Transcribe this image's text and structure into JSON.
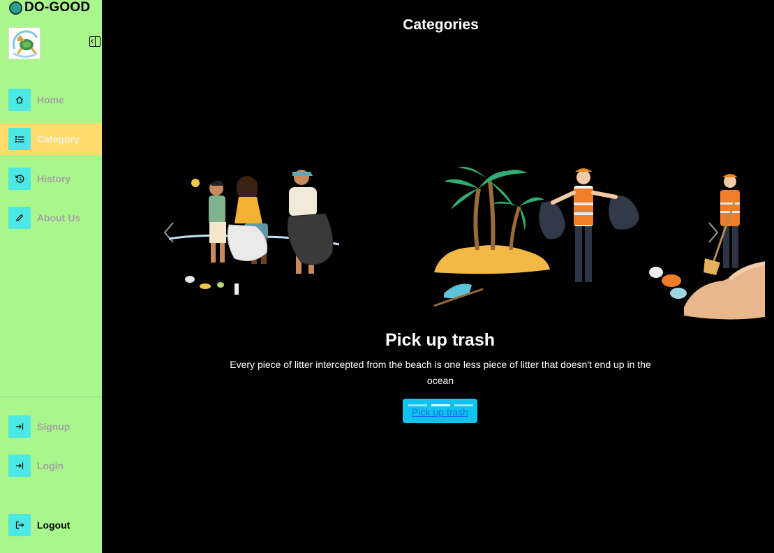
{
  "brand": {
    "name": "DO-GOOD"
  },
  "sidebar": {
    "nav": [
      {
        "label": "Home",
        "icon": "home-icon"
      },
      {
        "label": "Category",
        "icon": "list-icon",
        "active": true
      },
      {
        "label": "History",
        "icon": "history-icon"
      },
      {
        "label": "About Us",
        "icon": "pencil-icon"
      }
    ],
    "auth": [
      {
        "label": "Signup",
        "icon": "sign-in-icon"
      },
      {
        "label": "Login",
        "icon": "sign-in-icon"
      }
    ],
    "logout": {
      "label": "Logout",
      "icon": "sign-out-icon"
    }
  },
  "main": {
    "title": "Categories",
    "carousel": {
      "slide_title": "Pick up trash",
      "slide_description": "Every piece of litter intercepted from the beach is one less piece of litter that doesn't end up in the ocean",
      "button_label": "Pick up trash",
      "slide_count": 3,
      "active_slide": 2
    }
  },
  "colors": {
    "sidebar_bg": "#a9f68c",
    "active_item_bg": "#ffdc6b",
    "icon_bg": "#4ce8e4",
    "button_bg": "#0fc3ef"
  }
}
